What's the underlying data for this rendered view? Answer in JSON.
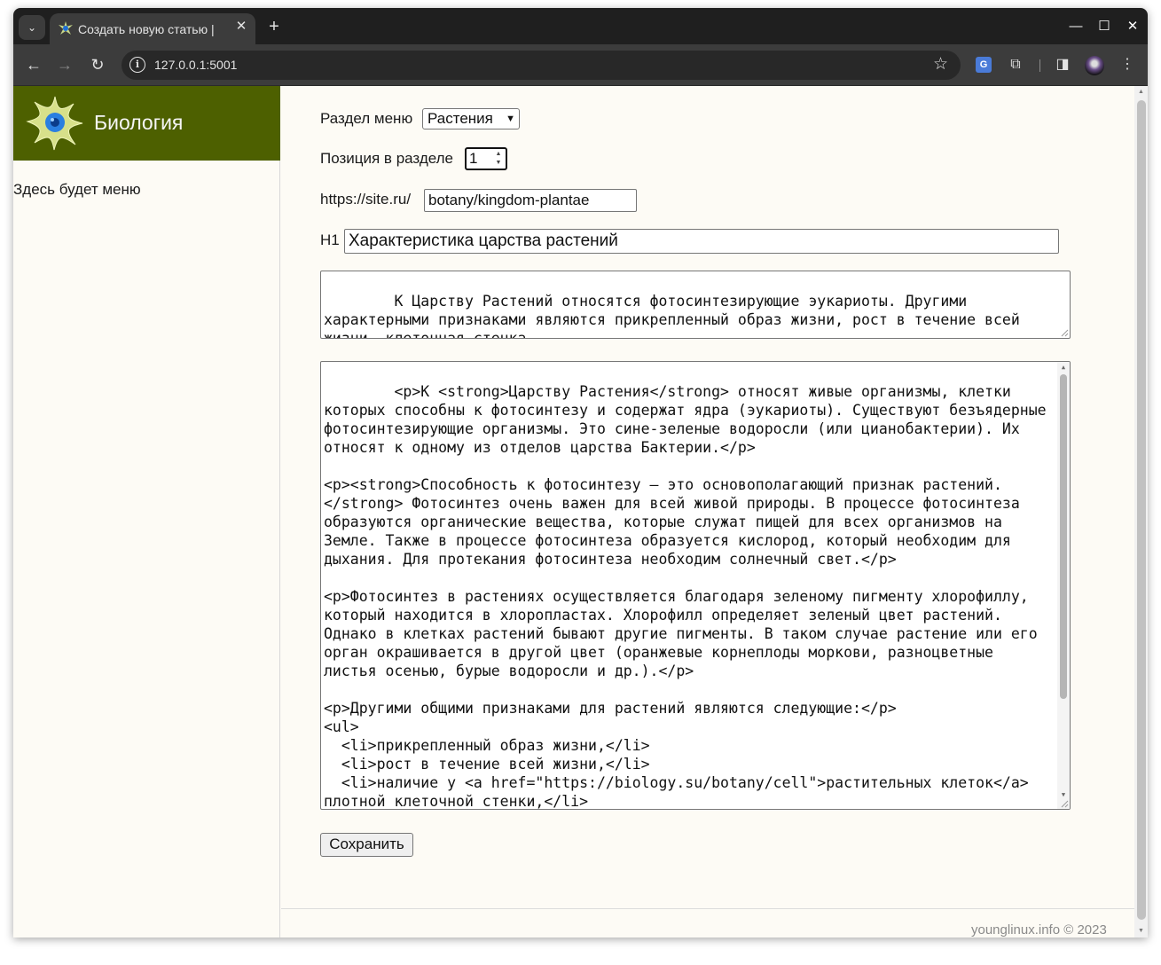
{
  "browser": {
    "tab_title": "Создать новую статью |",
    "tab_close": "✕",
    "new_tab": "+",
    "tab_search": "⌄",
    "url": "127.0.0.1:5001",
    "window_controls": {
      "minimize": "—",
      "maximize": "☐",
      "close": "✕"
    },
    "icons": {
      "back": "←",
      "forward": "→",
      "reload": "↻",
      "bookmark": "☆",
      "extensions": "⧉",
      "side_panel": "◨",
      "menu": "⋮",
      "site_info": "i",
      "translate": "G"
    }
  },
  "sidebar": {
    "brand": "Биология",
    "menu_note": "Здесь будет меню"
  },
  "form": {
    "section_label": "Раздел меню",
    "section_value": "Растения",
    "position_label": "Позиция в разделе",
    "position_value": "1",
    "url_prefix": "https://site.ru/",
    "slug_value": "botany/kingdom-plantae",
    "h1_label": "H1",
    "h1_value": "Характеристика царства растений",
    "description": "К Царству Растений относятся фотосинтезирующие эукариоты. Другими характерными признаками являются прикрепленный образ жизни, рост в течение всей жизни, клеточная стенка.",
    "content": "<p>К <strong>Царству Растения</strong> относят живые организмы, клетки которых способны к фотосинтезу и содержат ядра (эукариоты). Существуют безъядерные фотосинтезирующие организмы. Это сине-зеленые водоросли (или цианобактерии). Их относят к одному из отделов царства Бактерии.</p>\n\n<p><strong>Способность к фотосинтезу – это основополагающий признак растений.</strong> Фотосинтез очень важен для всей живой природы. В процессе фотосинтеза образуются органические вещества, которые служат пищей для всех организмов на Земле. Также в процессе фотосинтеза образуется кислород, который необходим для дыхания. Для протекания фотосинтеза необходим солнечный свет.</p>\n\n<p>Фотосинтез в растениях осуществляется благодаря зеленому пигменту хлорофиллу, который находится в хлоропластах. Хлорофилл определяет зеленый цвет растений. Однако в клетках растений бывают другие пигменты. В таком случае растение или его орган окрашивается в другой цвет (оранжевые корнеплоды моркови, разноцветные листья осенью, бурые водоросли и др.).</p>\n\n<p>Другими общими признаками для растений являются следующие:</p>\n<ul>\n  <li>прикрепленный образ жизни,</li>\n  <li>рост в течение всей жизни,</li>\n  <li>наличие у <a href=\"https://biology.su/botany/cell\">растительных клеток</a> плотной клеточной стенки,</li>",
    "save_label": "Сохранить"
  },
  "footer": "younglinux.info © 2023",
  "colors": {
    "brand_bg": "#4d6000",
    "page_bg": "#fdfbf5",
    "chrome_dark": "#1f1f1f",
    "toolbar": "#3c3c3c"
  }
}
